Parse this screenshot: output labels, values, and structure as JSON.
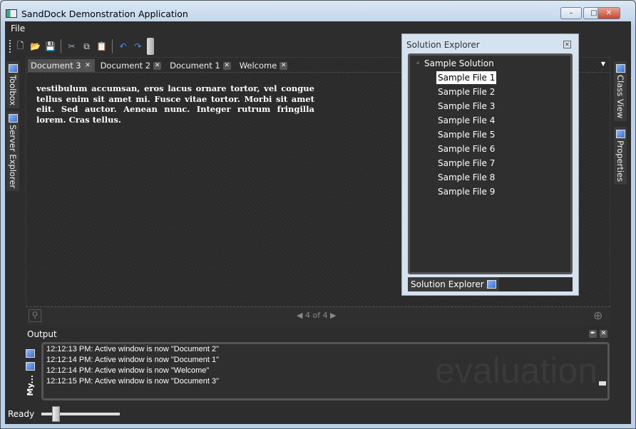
{
  "window": {
    "title": "SandDock Demonstration Application",
    "buttons": [
      "minimize",
      "maximize",
      "close"
    ]
  },
  "menu": {
    "items": [
      "File"
    ]
  },
  "toolbar": {
    "icons": [
      "new-icon",
      "open-icon",
      "save-icon",
      "cut-icon",
      "copy-icon",
      "paste-icon",
      "undo-icon",
      "redo-icon"
    ]
  },
  "left_dock": {
    "tabs": [
      "Toolbox",
      "Server Explorer"
    ]
  },
  "right_dock": {
    "tabs": [
      "Class View",
      "Properties"
    ]
  },
  "document": {
    "tabs": [
      {
        "label": "Document 3",
        "active": true
      },
      {
        "label": "Document 2"
      },
      {
        "label": "Document 1"
      },
      {
        "label": "Welcome"
      }
    ],
    "text": "vestibulum accumsan, eros lacus ornare tortor, vel congue tellus enim sit amet mi. Fusce vitae tortor. Morbi sit amet elit. Sed auctor. Aenean nunc. Integer rutrum fringilla lorem. Cras tellus.",
    "pager": "4 of 4"
  },
  "solution_explorer": {
    "title": "Solution Explorer",
    "root": "Sample Solution",
    "files": [
      "Sample File 1",
      "Sample File 2",
      "Sample File 3",
      "Sample File 4",
      "Sample File 5",
      "Sample File 6",
      "Sample File 7",
      "Sample File 8",
      "Sample File 9"
    ],
    "selected": "Sample File 1",
    "footer_tab": "Solution Explorer"
  },
  "output": {
    "title": "Output",
    "side_tab": "My...",
    "lines": [
      "12:12:13 PM: Active window is now \"Document 2\"",
      "12:12:14 PM: Active window is now \"Document 1\"",
      "12:12:14 PM: Active window is now \"Welcome\"",
      "12:12:15 PM: Active window is now \"Document 3\""
    ],
    "watermark": "evaluation"
  },
  "status": {
    "text": "Ready",
    "slider_value": 0.18
  },
  "colors": {
    "background": "#2d2d2d",
    "frame": "#b9d1ea"
  }
}
